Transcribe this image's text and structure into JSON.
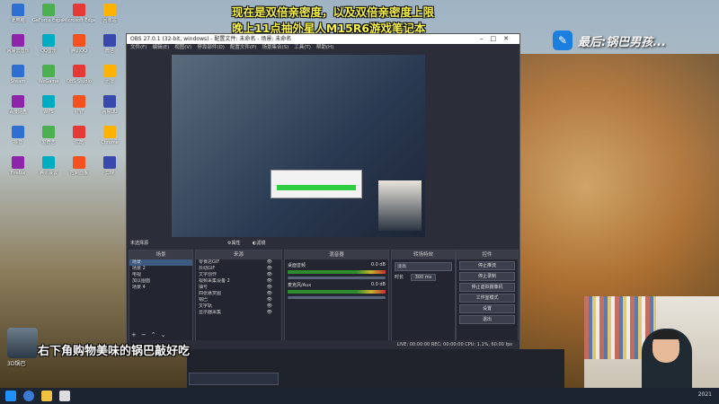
{
  "banner": {
    "line1": "现在是双倍亲密度，以及双倍亲密度上限",
    "line2": "晚上11点抽外星人M15R6游戏笔记本"
  },
  "logo": {
    "text": "最后:锅巴男孩..."
  },
  "obs": {
    "title": "OBS 27.0.1 (32-bit, windows) - 配置文件: 未命名 - 场景: 未命名",
    "menu": [
      "文件(F)",
      "编辑(E)",
      "视图(V)",
      "停靠部件(D)",
      "配置文件(P)",
      "场景集合(S)",
      "工具(T)",
      "帮助(H)"
    ],
    "preview_label": "未选择源",
    "props_btn": "属性",
    "filters_btn": "滤镜",
    "scenes_header": "场景",
    "sources_header": "来源",
    "mixer_header": "混音器",
    "transitions_header": "转场特效",
    "controls_header": "控件",
    "scenes": [
      "场景",
      "场景 2",
      "电视",
      "加以图面",
      "场景 4"
    ],
    "sources": [
      "零食店GIF",
      "抖动GIF",
      "文字创作",
      "视频采集设备 2",
      "抽号",
      "四张悬赏图",
      "锅巴",
      "文字轨",
      "显示器采集"
    ],
    "mixer": [
      {
        "name": "桌面音频",
        "value": "0.0 dB"
      },
      {
        "name": "麦克风/Aux",
        "value": "0.0 dB"
      }
    ],
    "transition": {
      "name": "淡出",
      "duration_label": "时长",
      "duration": "300 ms"
    },
    "controls": [
      "停止推流",
      "停止录制",
      "停止虚拟摄像机",
      "工作室模式",
      "设置",
      "退出"
    ],
    "status": {
      "text": "LIVE: 00:00:00   REC: 00:00:00   CPU: 1.1%, 60.00 fps",
      "cpu": "CPU: 1.1%, 60.00 fps"
    }
  },
  "overlay_cart": "右下角购物美味的锅巴敲好吃",
  "mini_cam_label": "3D锅巴",
  "desktop_icons": [
    "此电脑",
    "GeForce Experience",
    "Microsoft Edge",
    "回收站",
    "网易云音乐",
    "QQ音乐",
    "腾讯QQ",
    "微信",
    "Steam",
    "WeGame",
    "OBS Studio",
    "迅雷",
    "百度网盘",
    "WPS",
    "钉钉",
    "网易UU",
    "抖音",
    "爱奇艺",
    "优酷",
    "Chrome",
    "Firefox",
    "腾讯会议",
    "控制面板",
    "剪映"
  ],
  "taskbar": {
    "time": "2021"
  }
}
